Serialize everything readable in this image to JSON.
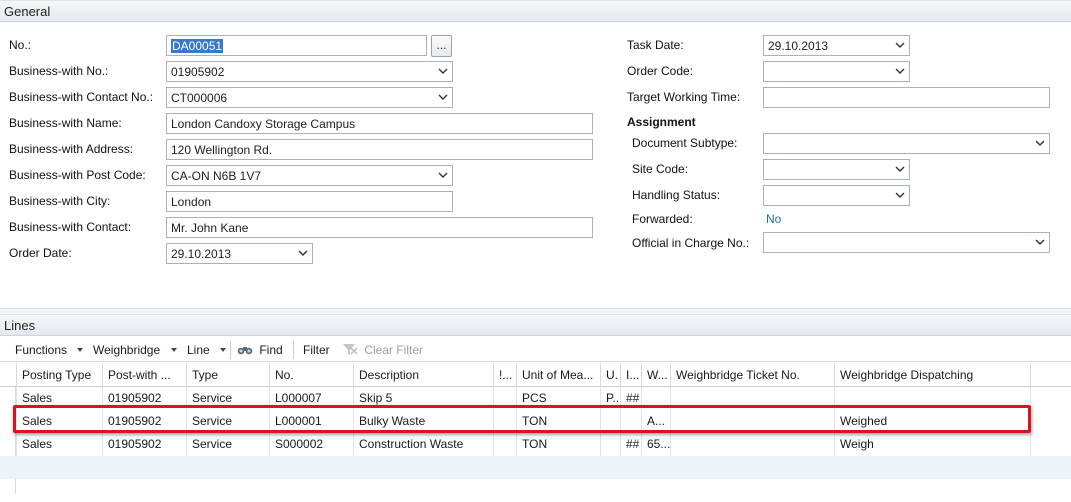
{
  "general": {
    "header": "General",
    "fields": {
      "no": {
        "label": "No.:",
        "value": "DA00051"
      },
      "bw_no": {
        "label": "Business-with No.:",
        "value": "01905902"
      },
      "bw_contact_no": {
        "label": "Business-with Contact No.:",
        "value": "CT000006"
      },
      "bw_name": {
        "label": "Business-with Name:",
        "value": "London Candoxy Storage Campus"
      },
      "bw_address": {
        "label": "Business-with Address:",
        "value": "120 Wellington Rd."
      },
      "bw_post_code": {
        "label": "Business-with Post Code:",
        "value": "CA-ON N6B 1V7"
      },
      "bw_city": {
        "label": "Business-with City:",
        "value": "London"
      },
      "bw_contact": {
        "label": "Business-with Contact:",
        "value": "Mr. John Kane"
      },
      "order_date": {
        "label": "Order Date:",
        "value": "29.10.2013"
      },
      "task_date": {
        "label": "Task Date:",
        "value": "29.10.2013"
      },
      "order_code": {
        "label": "Order Code:",
        "value": ""
      },
      "target_working_time": {
        "label": "Target Working Time:",
        "value": ""
      },
      "assignment_heading": "Assignment",
      "document_subtype": {
        "label": "Document Subtype:",
        "value": ""
      },
      "site_code": {
        "label": "Site Code:",
        "value": ""
      },
      "handling_status": {
        "label": "Handling Status:",
        "value": ""
      },
      "forwarded": {
        "label": "Forwarded:",
        "value": "No"
      },
      "official_in_charge": {
        "label": "Official in Charge No.:",
        "value": ""
      }
    },
    "ellipsis_button": "..."
  },
  "lines": {
    "header": "Lines",
    "toolbar": {
      "functions": "Functions",
      "weighbridge": "Weighbridge",
      "line": "Line",
      "find": "Find",
      "filter": "Filter",
      "clear_filter": "Clear Filter"
    },
    "columns": [
      "Posting Type",
      "Post-with ...",
      "Type",
      "No.",
      "Description",
      "!...",
      "Unit of Mea...",
      "U.",
      "I...",
      "W...",
      "Weighbridge Ticket No.",
      "Weighbridge Dispatching"
    ],
    "rows": [
      [
        "Sales",
        "01905902",
        "Service",
        "L000007",
        "Skip 5",
        "",
        "PCS",
        "P...",
        "##",
        "",
        "",
        ""
      ],
      [
        "Sales",
        "01905902",
        "Service",
        "L000001",
        "Bulky Waste",
        "",
        "TON",
        "",
        "",
        "A...",
        "",
        "Weighed"
      ],
      [
        "Sales",
        "01905902",
        "Service",
        "S000002",
        "Construction Waste",
        "",
        "TON",
        "",
        "##",
        "65...",
        "",
        "Weigh"
      ]
    ]
  },
  "colors": {
    "highlight": "#d8151c",
    "link": "#1e6fb5",
    "selection": "#3a78c9"
  }
}
